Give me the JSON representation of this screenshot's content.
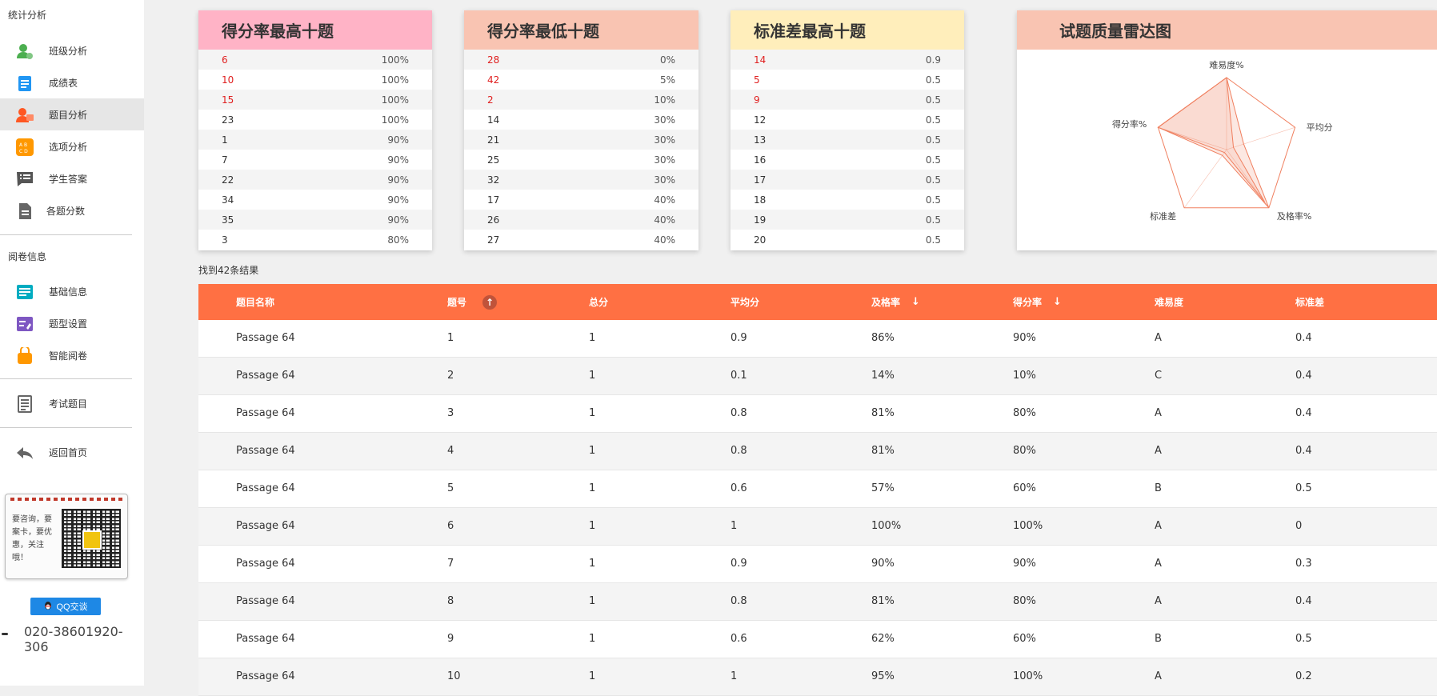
{
  "sidebar": {
    "section1": "统计分析",
    "items1": [
      {
        "label": "班级分析",
        "icon": "class-analysis-icon",
        "color": "#4caf50"
      },
      {
        "label": "成绩表",
        "icon": "score-sheet-icon",
        "color": "#2196f3"
      },
      {
        "label": "题目分析",
        "icon": "question-analysis-icon",
        "color": "#ff5722"
      },
      {
        "label": "选项分析",
        "icon": "option-analysis-icon",
        "color": "#ff9800"
      },
      {
        "label": "学生答案",
        "icon": "student-answer-icon",
        "color": "#555555"
      },
      {
        "label": "各题分数",
        "icon": "question-score-icon",
        "color": "#555555"
      }
    ],
    "section2": "阅卷信息",
    "items2": [
      {
        "label": "基础信息",
        "icon": "basic-info-icon",
        "color": "#00acc1"
      },
      {
        "label": "题型设置",
        "icon": "question-type-icon",
        "color": "#7e57c2"
      },
      {
        "label": "智能阅卷",
        "icon": "smart-grading-icon",
        "color": "#ff9800"
      }
    ],
    "items3": [
      {
        "label": "考试题目",
        "icon": "exam-questions-icon",
        "color": "#666666"
      }
    ],
    "items4": [
      {
        "label": "返回首页",
        "icon": "back-home-icon",
        "color": "#666666"
      }
    ],
    "active_item": "题目分析",
    "qr_text": "要咨询，要案卡，要优惠，关注哦！",
    "qq_label": "QQ交谈",
    "phone": "020-38601920-306"
  },
  "cards": [
    {
      "title": "得分率最高十题",
      "head_color": "#ffb3c6",
      "rows": [
        {
          "k": "6",
          "v": "100%",
          "red": true
        },
        {
          "k": "10",
          "v": "100%",
          "red": true
        },
        {
          "k": "15",
          "v": "100%",
          "red": true
        },
        {
          "k": "23",
          "v": "100%",
          "red": false
        },
        {
          "k": "1",
          "v": "90%",
          "red": false
        },
        {
          "k": "7",
          "v": "90%",
          "red": false
        },
        {
          "k": "22",
          "v": "90%",
          "red": false
        },
        {
          "k": "34",
          "v": "90%",
          "red": false
        },
        {
          "k": "35",
          "v": "90%",
          "red": false
        },
        {
          "k": "3",
          "v": "80%",
          "red": false
        }
      ]
    },
    {
      "title": "得分率最低十题",
      "head_color": "#f9c4b2",
      "rows": [
        {
          "k": "28",
          "v": "0%",
          "red": true
        },
        {
          "k": "42",
          "v": "5%",
          "red": true
        },
        {
          "k": "2",
          "v": "10%",
          "red": true
        },
        {
          "k": "14",
          "v": "30%",
          "red": false
        },
        {
          "k": "21",
          "v": "30%",
          "red": false
        },
        {
          "k": "25",
          "v": "30%",
          "red": false
        },
        {
          "k": "32",
          "v": "30%",
          "red": false
        },
        {
          "k": "17",
          "v": "40%",
          "red": false
        },
        {
          "k": "26",
          "v": "40%",
          "red": false
        },
        {
          "k": "27",
          "v": "40%",
          "red": false
        }
      ]
    },
    {
      "title": "标准差最高十题",
      "head_color": "#ffeebb",
      "rows": [
        {
          "k": "14",
          "v": "0.9",
          "red": true
        },
        {
          "k": "5",
          "v": "0.5",
          "red": true
        },
        {
          "k": "9",
          "v": "0.5",
          "red": true
        },
        {
          "k": "12",
          "v": "0.5",
          "red": false
        },
        {
          "k": "13",
          "v": "0.5",
          "red": false
        },
        {
          "k": "16",
          "v": "0.5",
          "red": false
        },
        {
          "k": "17",
          "v": "0.5",
          "red": false
        },
        {
          "k": "18",
          "v": "0.5",
          "red": false
        },
        {
          "k": "19",
          "v": "0.5",
          "red": false
        },
        {
          "k": "20",
          "v": "0.5",
          "red": false
        }
      ]
    }
  ],
  "radar": {
    "title": "试题质量雷达图",
    "color": "#f08060"
  },
  "chart_data": {
    "type": "radar",
    "title": "试题质量雷达图",
    "axes": [
      "难易度%",
      "平均分",
      "及格率%",
      "标准差",
      "得分率%"
    ],
    "range": [
      0,
      100
    ],
    "series": [
      {
        "values": [
          100,
          25,
          100,
          10,
          100
        ]
      },
      {
        "values": [
          100,
          10,
          90,
          5,
          100
        ]
      }
    ]
  },
  "result_count": "找到42条结果",
  "table": {
    "headers": [
      "题目名称",
      "题号",
      "总分",
      "平均分",
      "及格率",
      "得分率",
      "难易度",
      "标准差"
    ],
    "rows": [
      [
        "Passage 64",
        "1",
        "1",
        "0.9",
        "86%",
        "90%",
        "A",
        "0.4"
      ],
      [
        "Passage 64",
        "2",
        "1",
        "0.1",
        "14%",
        "10%",
        "C",
        "0.4"
      ],
      [
        "Passage 64",
        "3",
        "1",
        "0.8",
        "81%",
        "80%",
        "A",
        "0.4"
      ],
      [
        "Passage 64",
        "4",
        "1",
        "0.8",
        "81%",
        "80%",
        "A",
        "0.4"
      ],
      [
        "Passage 64",
        "5",
        "1",
        "0.6",
        "57%",
        "60%",
        "B",
        "0.5"
      ],
      [
        "Passage 64",
        "6",
        "1",
        "1",
        "100%",
        "100%",
        "A",
        "0"
      ],
      [
        "Passage 64",
        "7",
        "1",
        "0.9",
        "90%",
        "90%",
        "A",
        "0.3"
      ],
      [
        "Passage 64",
        "8",
        "1",
        "0.8",
        "81%",
        "80%",
        "A",
        "0.4"
      ],
      [
        "Passage 64",
        "9",
        "1",
        "0.6",
        "62%",
        "60%",
        "B",
        "0.5"
      ],
      [
        "Passage 64",
        "10",
        "1",
        "1",
        "95%",
        "100%",
        "A",
        "0.2"
      ]
    ],
    "header_color": "#ff7043"
  }
}
